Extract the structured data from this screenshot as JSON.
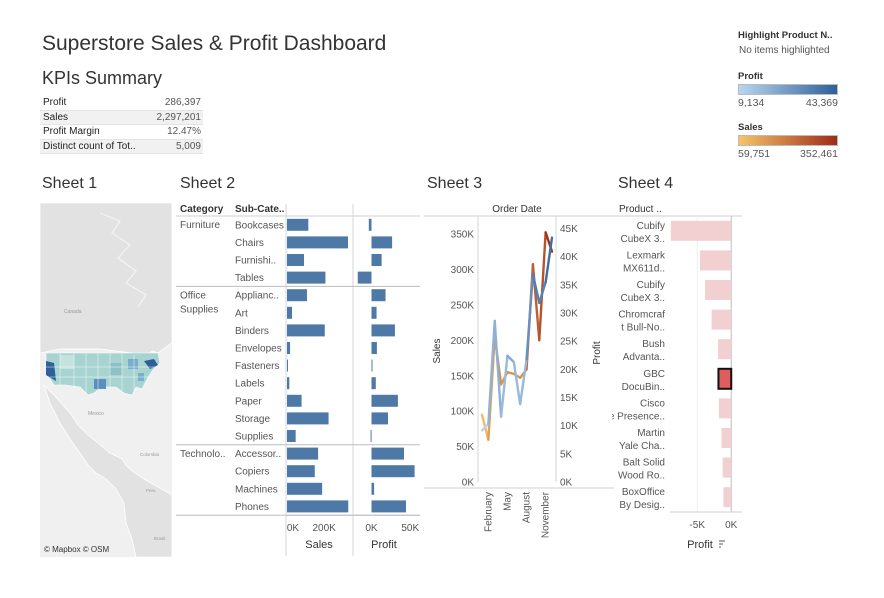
{
  "dashboard": {
    "title": "Superstore Sales & Profit Dashboard"
  },
  "kpis": {
    "title": "KPIs Summary",
    "rows": [
      {
        "label": "Profit",
        "value": "286,397"
      },
      {
        "label": "Sales",
        "value": "2,297,201"
      },
      {
        "label": "Profit Margin",
        "value": "12.47%"
      },
      {
        "label": "Distinct count of Tot..",
        "value": "5,009"
      }
    ]
  },
  "legends": {
    "highlight": {
      "title": "Highlight Product N..",
      "value": "No items highlighted"
    },
    "profit": {
      "title": "Profit",
      "min": "9,134",
      "max": "43,369",
      "color_min": "#b9d6ef",
      "color_max": "#2f5f9a"
    },
    "sales": {
      "title": "Sales",
      "min": "59,751",
      "max": "352,461",
      "color_min": "#f7c36a",
      "color_max": "#9e2c16"
    }
  },
  "sheet1": {
    "title": "Sheet 1",
    "credit": "© Mapbox © OSM",
    "map_labels": [
      "Canada",
      "Mexico",
      "Colombia",
      "Peru",
      "Brasil"
    ]
  },
  "sheet2": {
    "title": "Sheet 2",
    "col_category": "Category",
    "col_subcategory": "Sub-Cate..",
    "sales_label": "Sales",
    "profit_label": "Profit",
    "sales_ticks": [
      "0K",
      "200K"
    ],
    "profit_ticks": [
      "0K",
      "50K"
    ],
    "bar_color": "#4e79a7"
  },
  "chart_data": [
    {
      "type": "bar",
      "title": "Sheet 2",
      "groups": [
        {
          "category": "Furniture",
          "sub": [
            "Bookcases",
            "Chairs",
            "Furnishi..",
            "Tables"
          ]
        },
        {
          "category": "Office Supplies",
          "sub": [
            "Applianc..",
            "Art",
            "Binders",
            "Envelopes",
            "Fasteners",
            "Labels",
            "Paper",
            "Storage",
            "Supplies"
          ]
        },
        {
          "category": "Technolo..",
          "sub": [
            "Accessor..",
            "Copiers",
            "Machines",
            "Phones"
          ]
        }
      ],
      "series": [
        {
          "name": "Sales",
          "values": [
            114880,
            328449,
            91705,
            206966,
            107532,
            27119,
            203413,
            16476,
            3024,
            12486,
            78479,
            223844,
            46674,
            167380,
            149528,
            189239,
            330007
          ]
        },
        {
          "name": "Profit",
          "values": [
            -3473,
            26590,
            13059,
            -17725,
            18138,
            6528,
            30222,
            6964,
            950,
            5546,
            34054,
            21279,
            -1189,
            41937,
            55618,
            3385,
            44516
          ]
        }
      ],
      "xlim_sales": [
        0,
        350000
      ],
      "xlim_profit": [
        -20000,
        60000
      ]
    },
    {
      "type": "line",
      "title": "Sheet 3",
      "header": "Order Date",
      "x": [
        "January",
        "February",
        "March",
        "April",
        "May",
        "June",
        "July",
        "August",
        "September",
        "October",
        "November",
        "December"
      ],
      "x_tick_labels": [
        "February",
        "May",
        "August",
        "November"
      ],
      "ylabel": "Sales",
      "y2label": "Profit",
      "y_ticks": [
        "0K",
        "50K",
        "100K",
        "150K",
        "200K",
        "250K",
        "300K",
        "350K"
      ],
      "y2_ticks": [
        "0K",
        "5K",
        "10K",
        "15K",
        "20K",
        "25K",
        "30K",
        "35K",
        "40K",
        "45K"
      ],
      "ylim": [
        0,
        370000
      ],
      "y2lim": [
        0,
        46500
      ],
      "series": [
        {
          "name": "Sales",
          "values": [
            94925,
            59751,
            205005,
            137762,
            155028,
            152718,
            147238,
            159044,
            307650,
            200323,
            352461,
            325293
          ]
        },
        {
          "name": "Profit",
          "values": [
            9134,
            10295,
            28594,
            11588,
            22411,
            21285,
            13832,
            21776,
            36857,
            31784,
            35468,
            43369
          ]
        }
      ]
    },
    {
      "type": "bar",
      "title": "Sheet 4",
      "header": "Product ..",
      "categories": [
        "Cubify CubeX 3..",
        "Lexmark MX611d..",
        "Cubify CubeX 3..",
        "Chromcraf t Bull-No..",
        "Bush Advanta..",
        "GBC DocuBin..",
        "Cisco Tele Presence..",
        "Martin Yale Cha..",
        "Balt Solid Wood Ro..",
        "BoxOffice By Desig.."
      ],
      "values": [
        -8880,
        -4590,
        -3840,
        -2877,
        -1935,
        -1878,
        -1811,
        -1438,
        -1256,
        -1148
      ],
      "xlabel": "Profit",
      "x_ticks": [
        "-5K",
        "0K"
      ],
      "xlim": [
        -9000,
        700
      ]
    }
  ],
  "sheet3": {
    "title": "Sheet 3"
  },
  "sheet4": {
    "title": "Sheet 4"
  }
}
